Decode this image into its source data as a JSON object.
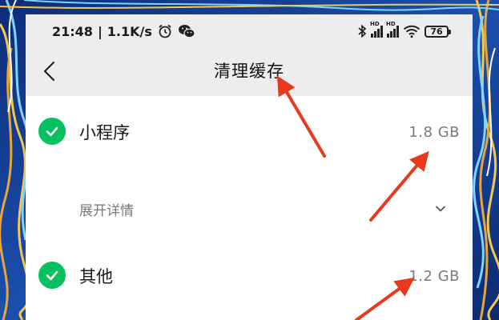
{
  "status_bar": {
    "time": "21:48",
    "separator": "|",
    "speed": "1.1K/s",
    "battery": "76",
    "signal_badge_1": "HD",
    "signal_badge_2": "HD"
  },
  "nav": {
    "title": "清理缓存"
  },
  "items": [
    {
      "label": "小程序",
      "size": "1.8 GB",
      "checked": true
    },
    {
      "label": "其他",
      "size": "1.2 GB",
      "checked": true
    }
  ],
  "expand": {
    "label": "展开详情"
  },
  "colors": {
    "accent_green": "#07c160",
    "annotation_arrow": "#e8391d",
    "header_bg": "#ededed"
  },
  "icons": {
    "back": "chevron-left-icon",
    "check": "check-circle-icon",
    "expand": "chevron-down-icon",
    "alarm": "alarm-icon",
    "wechat": "wechat-icon",
    "bluetooth": "bluetooth-icon",
    "wifi": "wifi-icon"
  }
}
